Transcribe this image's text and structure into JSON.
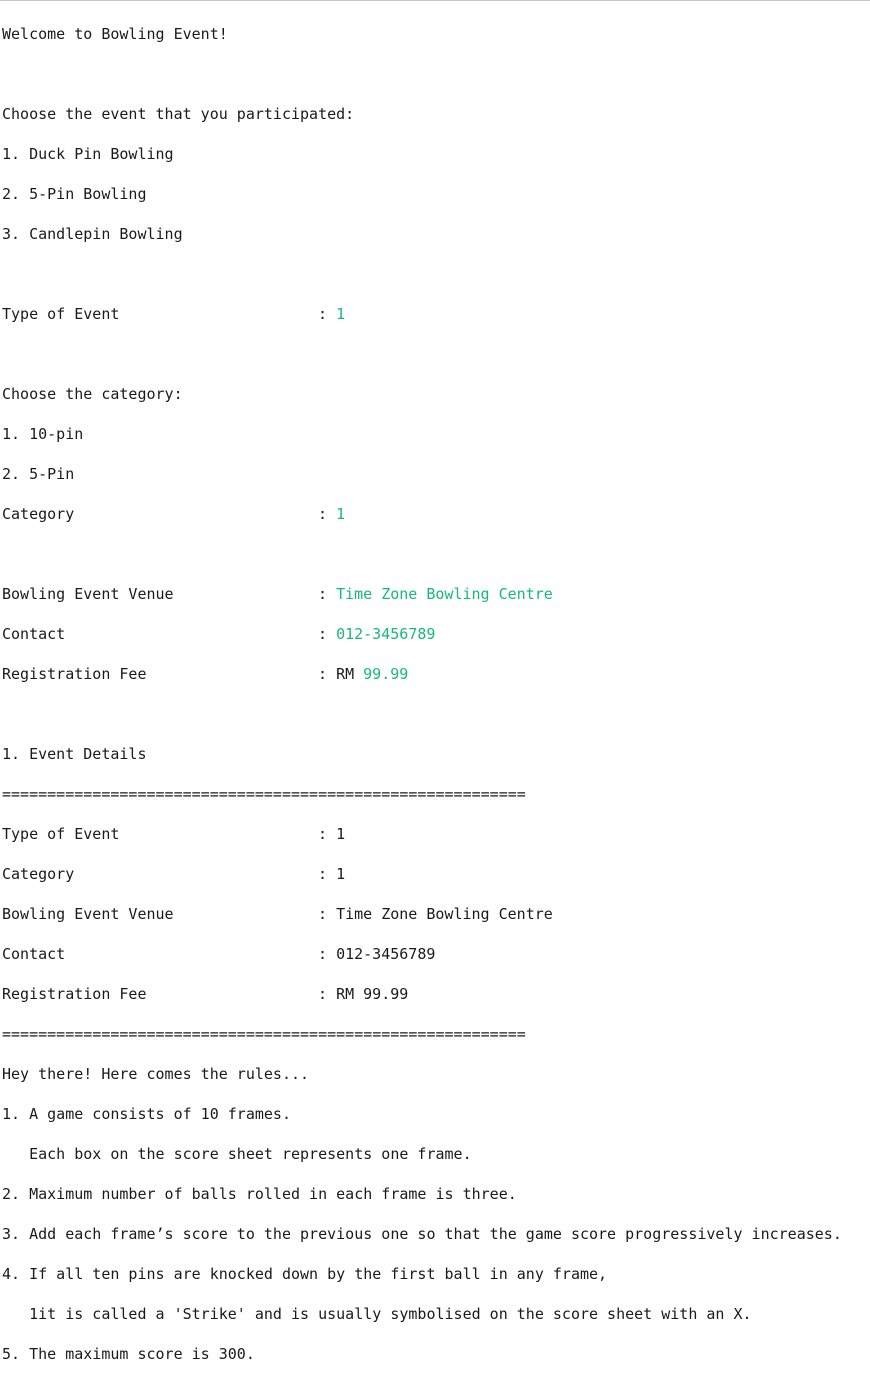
{
  "welcome": "Welcome to Bowling Event!",
  "event_prompt": "Choose the event that you participated:",
  "events": [
    "1. Duck Pin Bowling",
    "2. 5-Pin Bowling",
    "3. Candlepin Bowling"
  ],
  "input1": {
    "label": "Type of Event",
    "value": "1"
  },
  "category_prompt": "Choose the category:",
  "categories": [
    "1. 10-pin",
    "2. 5-Pin"
  ],
  "input2": {
    "label": "Category",
    "value": "1"
  },
  "venue": {
    "label": "Bowling Event Venue",
    "value": "Time Zone Bowling Centre"
  },
  "contact": {
    "label": "Contact",
    "value": "012-3456789"
  },
  "fee": {
    "label": "Registration Fee",
    "currency": "RM",
    "value": "99.99"
  },
  "separator_colon": ": ",
  "details": {
    "heading": "1. Event Details",
    "separator": "==========================================================",
    "rows": [
      {
        "label": "Type of Event",
        "value": "1"
      },
      {
        "label": "Category",
        "value": "1"
      },
      {
        "label": "Bowling Event Venue",
        "value": "Time Zone Bowling Centre"
      },
      {
        "label": "Contact",
        "value": "012-3456789"
      },
      {
        "label": "Registration Fee",
        "value": "RM 99.99"
      }
    ]
  },
  "rules": {
    "intro": "Hey there! Here comes the rules...",
    "lines": [
      "1. A game consists of 10 frames.",
      "   Each box on the score sheet represents one frame.",
      "2. Maximum number of balls rolled in each frame is three.",
      "3. Add each frame’s score to the previous one so that the game score progressively increases.",
      "4. If all ten pins are knocked down by the first ball in any frame,",
      "   1it is called a 'Strike' and is usually symbolised on the score sheet with an X.",
      "5. The maximum score is 300."
    ]
  }
}
